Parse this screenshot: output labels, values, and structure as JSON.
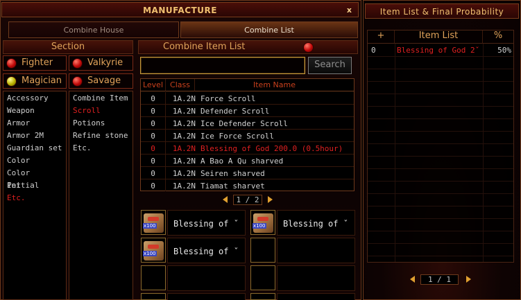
{
  "manufacture": {
    "title": "MANUFACTURE",
    "close_label": "x",
    "tabs": [
      {
        "label": "Combine House",
        "active": false
      },
      {
        "label": "Combine List",
        "active": true
      }
    ],
    "section_header": "Section",
    "classes": [
      {
        "label": "Fighter",
        "gem": "red"
      },
      {
        "label": "Valkyrie",
        "gem": "red"
      },
      {
        "label": "Magician",
        "gem": "yellow"
      },
      {
        "label": "Savage",
        "gem": "red"
      }
    ],
    "categories": [
      "Accessory",
      "Weapon",
      "Armor",
      "Armor 2M",
      "Guardian set",
      "Color",
      "Color Initial",
      "Pet",
      "Etc."
    ],
    "selected_category": "Etc.",
    "subcategories": [
      "Combine Item",
      "Scroll",
      "Potions",
      "Refine stone",
      "Etc."
    ],
    "selected_subcategory": "Scroll",
    "combine_list_header": "Combine Item List",
    "search": {
      "value": "",
      "button_label": "Search"
    },
    "table": {
      "headers": [
        "Level",
        "Class",
        "Item Name"
      ],
      "rows": [
        {
          "level": "0",
          "class": "1A.2N",
          "name": "Force Scroll",
          "highlight": false
        },
        {
          "level": "0",
          "class": "1A.2N",
          "name": "Defender Scroll",
          "highlight": false
        },
        {
          "level": "0",
          "class": "1A.2N",
          "name": "Ice Defender Scroll",
          "highlight": false
        },
        {
          "level": "0",
          "class": "1A.2N",
          "name": "Ice Force Scroll",
          "highlight": false
        },
        {
          "level": "0",
          "class": "1A.2N",
          "name": "Blessing of God 200.0 (0.5hour)",
          "highlight": true
        },
        {
          "level": "0",
          "class": "1A.2N",
          "name": "A Bao A Qu sharved",
          "highlight": false
        },
        {
          "level": "0",
          "class": "1A.2N",
          "name": "Seiren sharved",
          "highlight": false
        },
        {
          "level": "0",
          "class": "1A.2N",
          "name": "Tiamat sharvet",
          "highlight": false
        }
      ]
    },
    "pager": "1 / 2",
    "materials": [
      {
        "name": "Blessing of ˇ",
        "qty": "x100"
      },
      {
        "name": "Blessing of ˇ",
        "qty": "x100"
      },
      {
        "name": "Blessing of ˇ",
        "qty": "x100"
      }
    ]
  },
  "final_probability": {
    "title": "Item List & Final Probability",
    "headers": [
      "+",
      "Item List",
      "%"
    ],
    "rows": [
      {
        "plus": "0",
        "item": "Blessing of God 2ˇ",
        "percent": "50%"
      }
    ],
    "pager": "1 / 1"
  },
  "colors": {
    "accent_gold": "#e0a35a",
    "highlight_red": "#e02020",
    "border_brown": "#6e3a1c"
  }
}
